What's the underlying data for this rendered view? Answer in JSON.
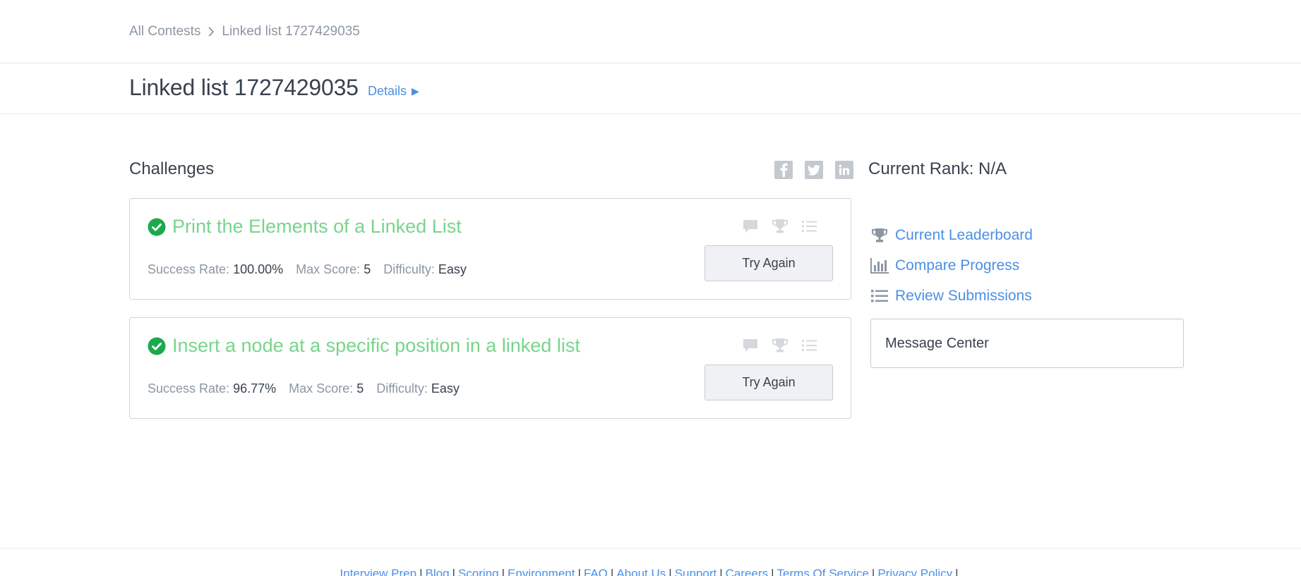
{
  "breadcrumb": {
    "root": "All Contests",
    "current": "Linked list 1727429035"
  },
  "header": {
    "title": "Linked list 1727429035",
    "details_label": "Details"
  },
  "challenges": {
    "section_title": "Challenges",
    "items": [
      {
        "title": "Print the Elements of a Linked List",
        "success_rate_label": "Success Rate:",
        "success_rate": "100.00%",
        "max_score_label": "Max Score:",
        "max_score": "5",
        "difficulty_label": "Difficulty:",
        "difficulty": "Easy",
        "button_label": "Try Again",
        "solved": true
      },
      {
        "title": "Insert a node at a specific position in a linked list",
        "success_rate_label": "Success Rate:",
        "success_rate": "96.77%",
        "max_score_label": "Max Score:",
        "max_score": "5",
        "difficulty_label": "Difficulty:",
        "difficulty": "Easy",
        "button_label": "Try Again",
        "solved": true
      }
    ]
  },
  "share": {
    "icons": [
      "facebook-icon",
      "twitter-icon",
      "linkedin-icon"
    ]
  },
  "sidebar": {
    "rank_text": "Current Rank: N/A",
    "links": [
      {
        "label": "Current Leaderboard",
        "icon": "trophy-icon"
      },
      {
        "label": "Compare Progress",
        "icon": "bar-chart-icon"
      },
      {
        "label": "Review Submissions",
        "icon": "list-icon"
      }
    ],
    "message_center": "Message Center"
  },
  "footer": {
    "links": [
      "Interview Prep",
      "Blog",
      "Scoring",
      "Environment",
      "FAQ",
      "About Us",
      "Support",
      "Careers",
      "Terms Of Service",
      "Privacy Policy"
    ]
  },
  "colors": {
    "link": "#4b8fe6",
    "solved": "#78d48c",
    "check": "#1ba94c",
    "muted": "#8c96a3",
    "text": "#39424e"
  }
}
